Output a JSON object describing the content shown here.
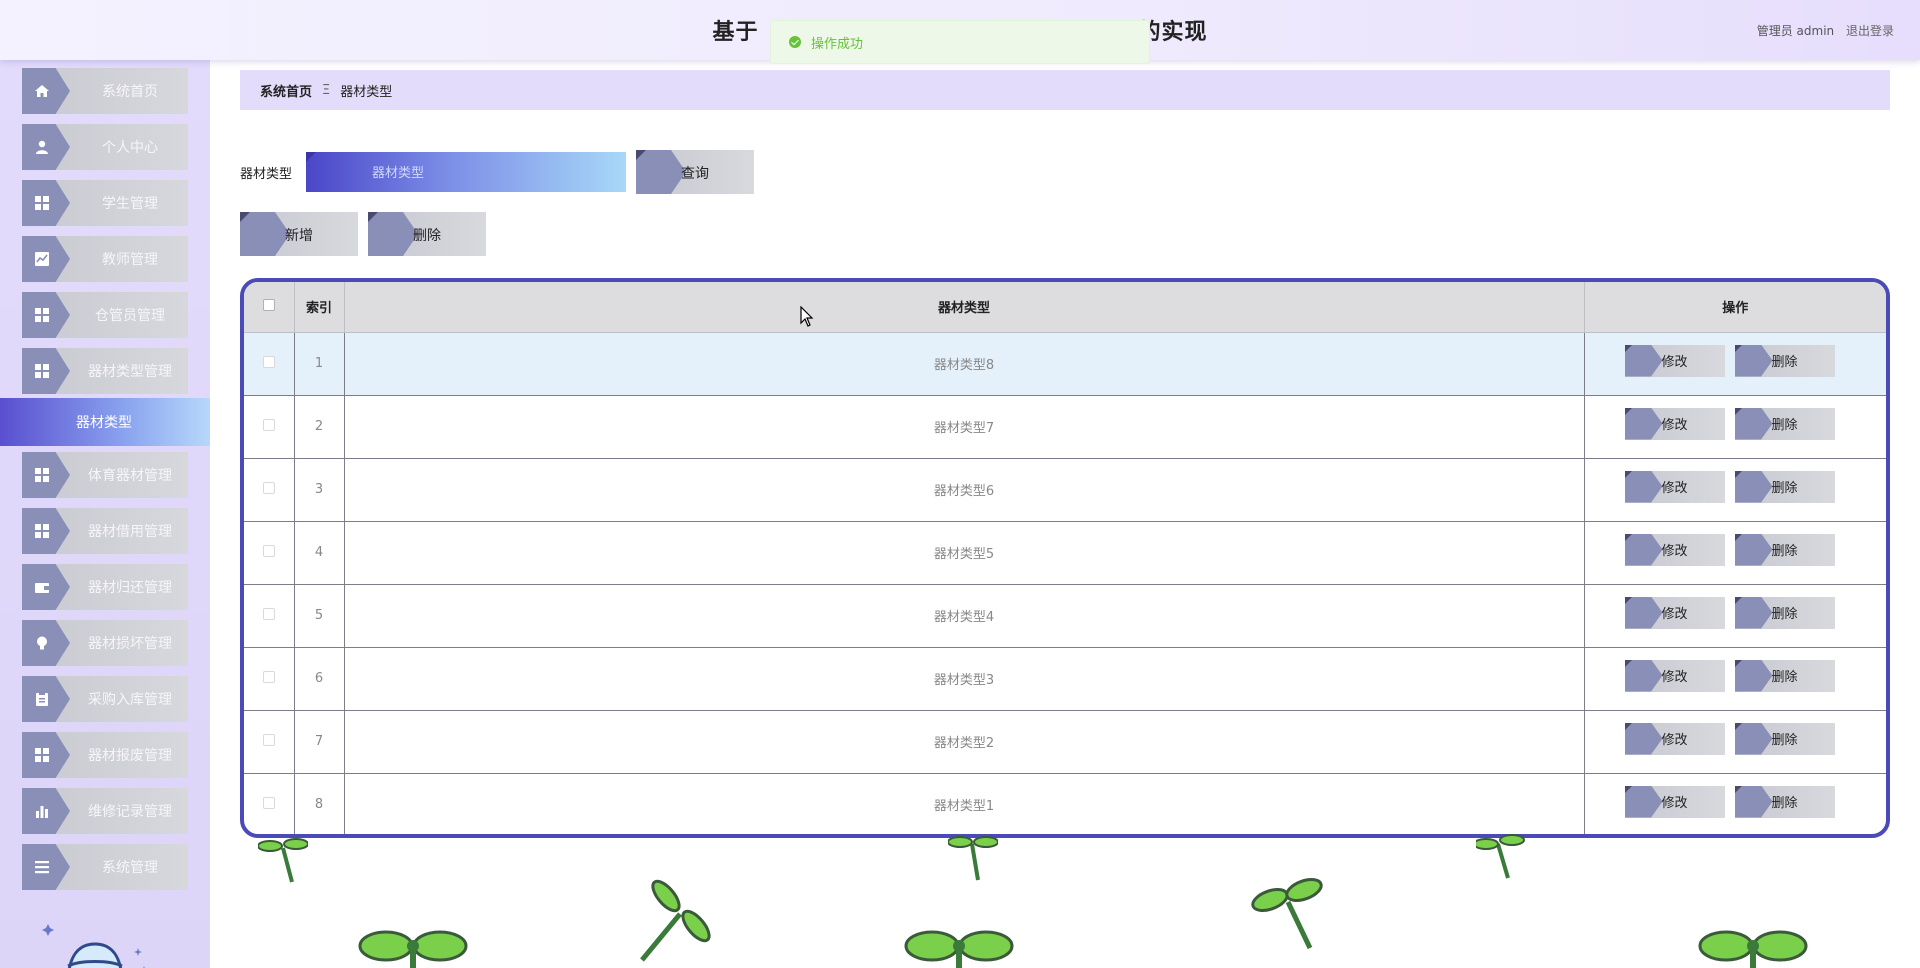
{
  "header": {
    "title_left": "基于",
    "title_right": "的实现",
    "role_user": "管理员 admin",
    "logout": "退出登录"
  },
  "toast": {
    "message": "操作成功",
    "color": "#67c23a"
  },
  "sidebar": {
    "items": [
      {
        "label": "系统首页",
        "icon": "home-icon"
      },
      {
        "label": "个人中心",
        "icon": "user-icon"
      },
      {
        "label": "学生管理",
        "icon": "grid-icon"
      },
      {
        "label": "教师管理",
        "icon": "chart-icon"
      },
      {
        "label": "仓管员管理",
        "icon": "grid-icon"
      },
      {
        "label": "器材类型管理",
        "icon": "grid-icon"
      }
    ],
    "active_sub": {
      "label": "器材类型"
    },
    "items_after": [
      {
        "label": "体育器材管理",
        "icon": "grid-icon"
      },
      {
        "label": "器材借用管理",
        "icon": "grid-icon"
      },
      {
        "label": "器材归还管理",
        "icon": "wallet-icon"
      },
      {
        "label": "器材损坏管理",
        "icon": "bulb-icon"
      },
      {
        "label": "采购入库管理",
        "icon": "clipboard-icon"
      },
      {
        "label": "器材报废管理",
        "icon": "grid-icon"
      },
      {
        "label": "维修记录管理",
        "icon": "bar-chart-icon"
      },
      {
        "label": "系统管理",
        "icon": "list-icon"
      }
    ]
  },
  "breadcrumb": {
    "home": "系统首页",
    "separator": "Ξ",
    "current": "器材类型"
  },
  "search": {
    "label": "器材类型",
    "placeholder": "器材类型",
    "button": "查询"
  },
  "actions": {
    "add": "新增",
    "delete": "删除"
  },
  "table": {
    "columns": {
      "index": "索引",
      "type": "器材类型",
      "ops": "操作"
    },
    "edit_label": "修改",
    "delete_label": "删除",
    "rows": [
      {
        "index": "1",
        "type": "器材类型8"
      },
      {
        "index": "2",
        "type": "器材类型7"
      },
      {
        "index": "3",
        "type": "器材类型6"
      },
      {
        "index": "4",
        "type": "器材类型5"
      },
      {
        "index": "5",
        "type": "器材类型4"
      },
      {
        "index": "6",
        "type": "器材类型3"
      },
      {
        "index": "7",
        "type": "器材类型2"
      },
      {
        "index": "8",
        "type": "器材类型1"
      }
    ]
  },
  "colors": {
    "accent": "#4a4ab8",
    "sidebar_bg": "#e2dbfb",
    "breadcrumb_bg": "#e4dcfb",
    "button_shape": "#8a8fb8"
  }
}
